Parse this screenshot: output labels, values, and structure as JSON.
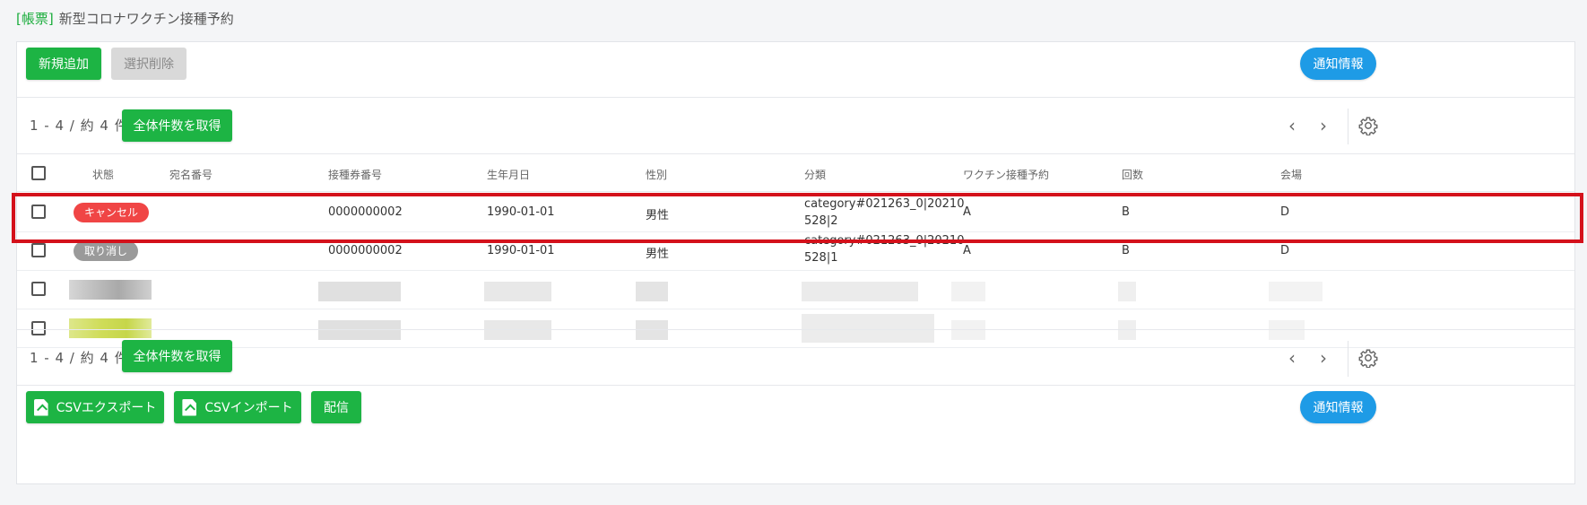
{
  "page": {
    "tag": "[帳票]",
    "title": "新型コロナワクチン接種予約"
  },
  "toolbar": {
    "add_label": "新規追加",
    "delete_label": "選択削除",
    "notify_label": "通知情報"
  },
  "pager": {
    "count_text": "1 - 4 / 約 4 件",
    "fetch_total_label": "全体件数を取得"
  },
  "table": {
    "headers": [
      "状態",
      "宛名番号",
      "接種券番号",
      "生年月日",
      "性別",
      "分類",
      "ワクチン接種予約",
      "回数",
      "会場"
    ],
    "rows": [
      {
        "status": "キャンセル",
        "status_color": "#f04545",
        "address_no": "",
        "ticket_no": "0000000002",
        "birth": "1990-01-01",
        "gender": "男性",
        "category_l1": "category#021263_0|20210",
        "category_l2": "528|2",
        "reservation": "A",
        "count": "B",
        "venue": "D"
      },
      {
        "status": "取り消し",
        "status_color": "#9a9a9a",
        "address_no": "",
        "ticket_no": "0000000002",
        "birth": "1990-01-01",
        "gender": "男性",
        "category_l1": "category#021263_0|20210",
        "category_l2": "528|1",
        "reservation": "A",
        "count": "B",
        "venue": "D"
      }
    ]
  },
  "footer": {
    "csv_export_label": "CSVエクスポート",
    "csv_import_label": "CSVインポート",
    "distribute_label": "配信",
    "notify_label": "通知情報"
  },
  "colors": {
    "accent_green": "#1db444",
    "accent_blue": "#1e9be6",
    "highlight_red": "#d4111b"
  }
}
